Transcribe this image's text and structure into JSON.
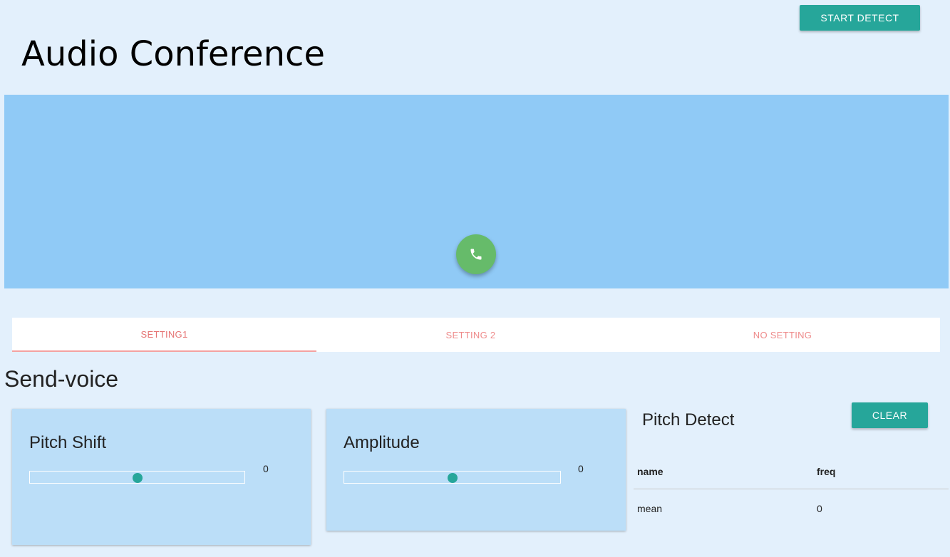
{
  "header": {
    "title": "Audio Conference",
    "start_detect_label": "START DETECT"
  },
  "stage": {
    "call_icon": "phone-icon",
    "call_color": "#66bb6a",
    "background_color": "#90caf6"
  },
  "tabs": [
    {
      "label": "SETTING1",
      "active": true
    },
    {
      "label": "SETTING 2",
      "active": false
    },
    {
      "label": "NO SETTING",
      "active": false
    }
  ],
  "send_voice": {
    "title": "Send-voice",
    "pitch_shift": {
      "title": "Pitch Shift",
      "value": "0",
      "level": 0.5
    },
    "amplitude": {
      "title": "Amplitude",
      "value": "0",
      "level": 0.5
    }
  },
  "pitch_detect": {
    "title": "Pitch Detect",
    "clear_label": "CLEAR",
    "columns": [
      "name",
      "freq"
    ],
    "rows": [
      {
        "name": "mean",
        "freq": "0"
      }
    ]
  },
  "colors": {
    "accent": "#26a69a",
    "tab_text": "#e57373",
    "page_background": "#e3f0fc",
    "card_background": "#bbdef8"
  }
}
